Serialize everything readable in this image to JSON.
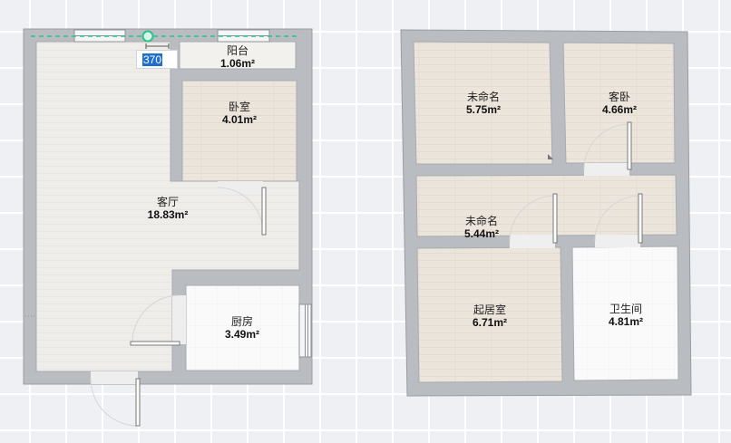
{
  "floorplan_left": {
    "rooms": [
      {
        "name": "阳台",
        "area": "1.06m²"
      },
      {
        "name": "卧室",
        "area": "4.01m²"
      },
      {
        "name": "客厅",
        "area": "18.83m²"
      },
      {
        "name": "厨房",
        "area": "3.49m²"
      }
    ],
    "dimension_value": "370"
  },
  "floorplan_right": {
    "rooms": [
      {
        "name": "未命名",
        "area": "5.75m²"
      },
      {
        "name": "客卧",
        "area": "4.66m²"
      },
      {
        "name": "未命名",
        "area": "5.44m²"
      },
      {
        "name": "起居室",
        "area": "6.71m²"
      },
      {
        "name": "卫生间",
        "area": "4.81m²"
      }
    ]
  },
  "colors": {
    "wall": "#b9bcc0",
    "wall_stroke": "#9a9da1",
    "floor_wood": "#ece5dc",
    "floor_light": "#efedea",
    "floor_tile": "#fafafa",
    "measure_line": "#2ec18a"
  }
}
